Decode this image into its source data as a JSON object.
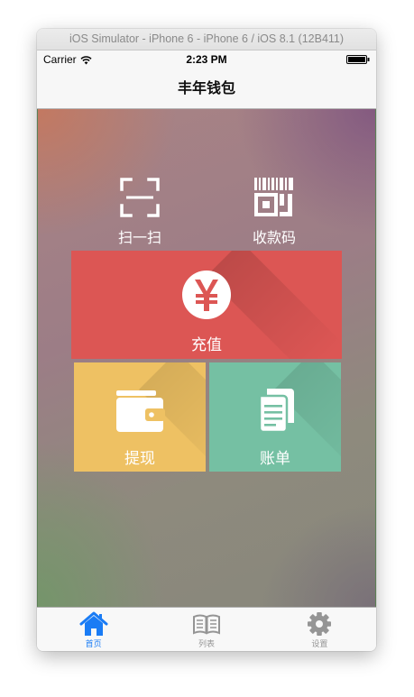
{
  "window": {
    "title": "iOS Simulator - iPhone 6 - iPhone 6 / iOS 8.1 (12B411)"
  },
  "statusbar": {
    "carrier": "Carrier",
    "time": "2:23 PM"
  },
  "navbar": {
    "title": "丰年钱包"
  },
  "actions": {
    "scan": {
      "label": "扫一扫",
      "icon": "scan-icon"
    },
    "receive": {
      "label": "收款码",
      "icon": "qr-code-icon"
    }
  },
  "tiles": {
    "recharge": {
      "label": "充值",
      "icon": "yen-icon",
      "color": "#dc5654"
    },
    "withdraw": {
      "label": "提现",
      "icon": "wallet-icon",
      "color": "#eec163"
    },
    "bill": {
      "label": "账单",
      "icon": "document-icon",
      "color": "#75c0a3"
    }
  },
  "tabbar": {
    "active_color": "#1a7cf5",
    "inactive_color": "#959595",
    "items": [
      {
        "label": "首页",
        "icon": "home-icon",
        "active": true
      },
      {
        "label": "列表",
        "icon": "book-icon",
        "active": false
      },
      {
        "label": "设置",
        "icon": "gear-icon",
        "active": false
      }
    ]
  }
}
